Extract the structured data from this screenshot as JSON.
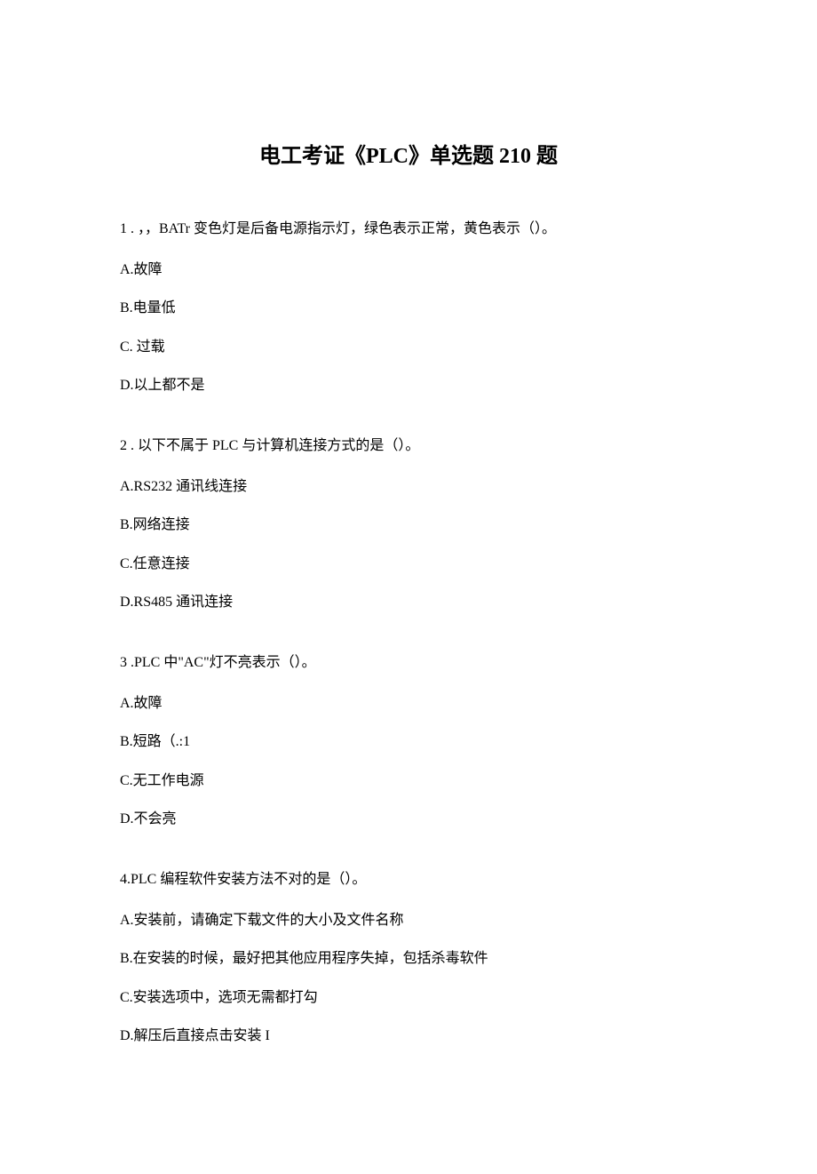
{
  "title": "电工考证《PLC》单选题 210 题",
  "questions": [
    {
      "prompt": "1 . ，，BATr 变色灯是后备电源指示灯，绿色表示正常，黄色表示（）。",
      "options": [
        "A.故障",
        "B.电量低",
        "C. 过载",
        "D.以上都不是"
      ]
    },
    {
      "prompt": "2  . 以下不属于 PLC 与计算机连接方式的是（）。",
      "options": [
        "A.RS232 通讯线连接",
        "B.网络连接",
        "C.任意连接",
        "D.RS485 通讯连接"
      ]
    },
    {
      "prompt": "3  .PLC 中\"AC\"灯不亮表示（）。",
      "options": [
        "A.故障",
        "B.短路（.:1",
        "C.无工作电源",
        "D.不会亮"
      ]
    },
    {
      "prompt": "4.PLC 编程软件安装方法不对的是（）。",
      "options": [
        "A.安装前，请确定下载文件的大小及文件名称",
        "B.在安装的时候，最好把其他应用程序失掉，包括杀毒软件",
        "C.安装选项中，选项无需都打勾",
        "D.解压后直接点击安装 I"
      ]
    }
  ]
}
